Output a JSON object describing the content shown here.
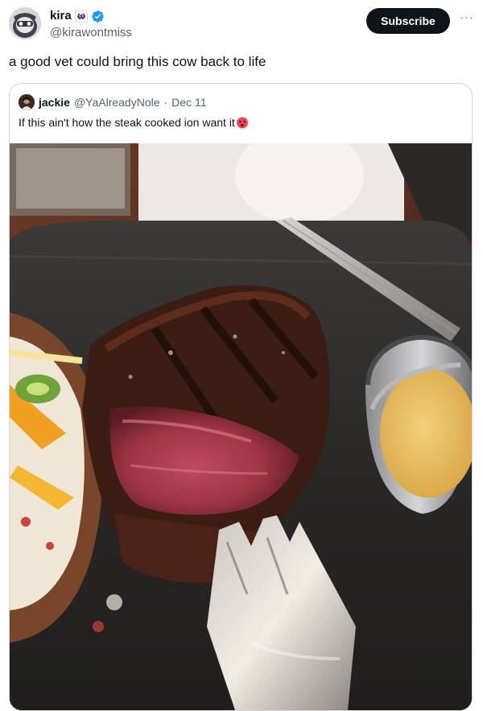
{
  "tweet": {
    "author": {
      "display_name": "kira",
      "handle": "@kirawontmiss"
    },
    "subscribe_label": "Subscribe",
    "more_label": "···",
    "text": "a good vet could bring this cow back to life"
  },
  "quote": {
    "author": {
      "display_name": "jackie",
      "handle": "@YaAlreadyNole"
    },
    "separator": "·",
    "date": "Dec 11",
    "text": "If this ain't how the steak cooked ion want it"
  },
  "icons": {
    "verified": "verified-badge-icon",
    "affiliate": "alien-affiliate-badge-icon",
    "more": "more-horizontal-icon",
    "emoji": "hot-face-emoji-icon"
  },
  "colors": {
    "verified_blue": "#1d9bf0",
    "text_primary": "#0f1419",
    "text_secondary": "#536471",
    "button_bg": "#0f1419",
    "border": "#cfd9de"
  },
  "media": {
    "description_icon": "steak-photo"
  }
}
